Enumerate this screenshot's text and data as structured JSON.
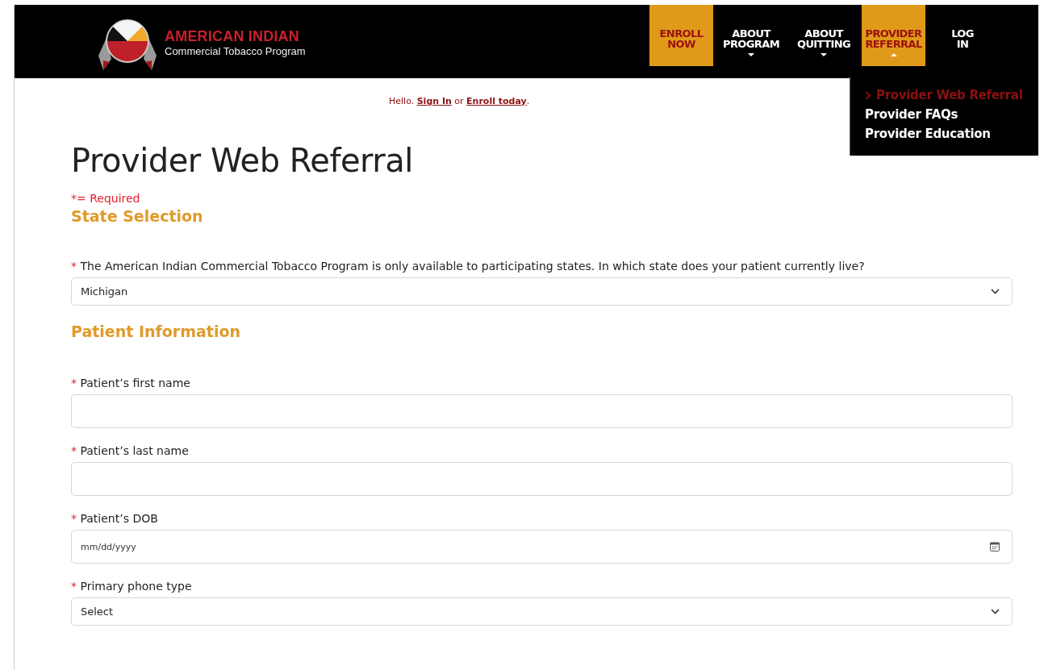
{
  "logo": {
    "title": "AMERICAN INDIAN",
    "subtitle": "Commercial Tobacco Program"
  },
  "nav": [
    {
      "label": "ENROLL NOW",
      "highlighted": true
    },
    {
      "label": "ABOUT PROGRAM",
      "highlighted": false,
      "expanded": false
    },
    {
      "label": "ABOUT QUITTING",
      "highlighted": false,
      "expanded": false
    },
    {
      "label": "PROVIDER REFERRAL",
      "highlighted": true,
      "expanded": true
    },
    {
      "label": "LOG IN",
      "highlighted": false
    }
  ],
  "submenu": [
    {
      "label": "Provider Web Referral",
      "selected": true
    },
    {
      "label": "Provider FAQs",
      "selected": false
    },
    {
      "label": "Provider Education",
      "selected": false
    }
  ],
  "greeting": {
    "text_1": "Hello.",
    "link_1": "Sign In",
    "text_2": "or",
    "link_2": "Enroll today",
    "text_3": "."
  },
  "page_title": "Provider Web Referral",
  "required_note": "*= Required",
  "sections": [
    {
      "heading": "State Selection",
      "fields": [
        {
          "kind": "select",
          "label": "The American Indian Commercial Tobacco Program is only available to participating states. In which state does your patient currently live?",
          "required_mark": "*",
          "value": "Michigan"
        }
      ]
    },
    {
      "heading": "Patient Information",
      "fields": [
        {
          "kind": "text",
          "label": "Patient’s first name",
          "required_mark": "*"
        },
        {
          "kind": "text",
          "label": "Patient’s last name",
          "required_mark": "*"
        },
        {
          "kind": "date",
          "label": "Patient’s DOB",
          "required_mark": "*",
          "placeholder": "mm/dd/yyyy"
        },
        {
          "kind": "select",
          "label": "Primary phone type",
          "required_mark": "*",
          "value": "Select"
        }
      ]
    }
  ]
}
